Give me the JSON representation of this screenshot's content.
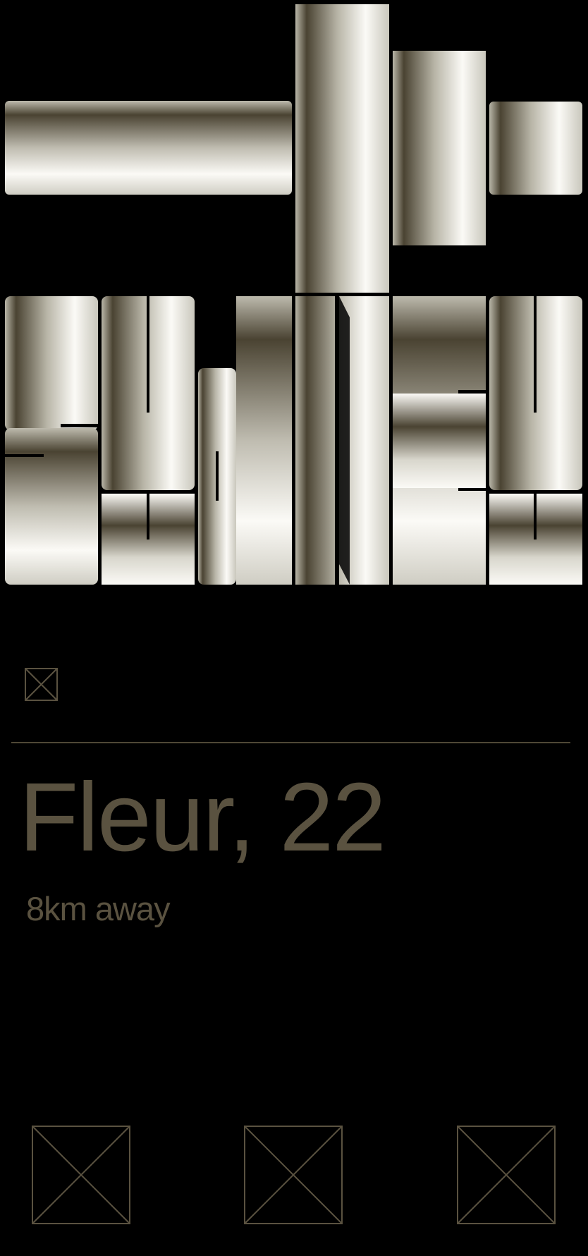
{
  "profile": {
    "name_age": "Fleur, 22",
    "distance": "8km away"
  },
  "hero": {
    "icon": "metallic-block-artwork",
    "lettering": "SYDNEY"
  },
  "placeholders": {
    "top_icon": "image-placeholder-icon",
    "actions": [
      "image-placeholder-icon",
      "image-placeholder-icon",
      "image-placeholder-icon"
    ]
  },
  "colors": {
    "background": "#000000",
    "accent": "#5a5240",
    "line": "#4f4836",
    "metal_light": "#fbfaf6",
    "metal_dark": "#4a4332"
  }
}
